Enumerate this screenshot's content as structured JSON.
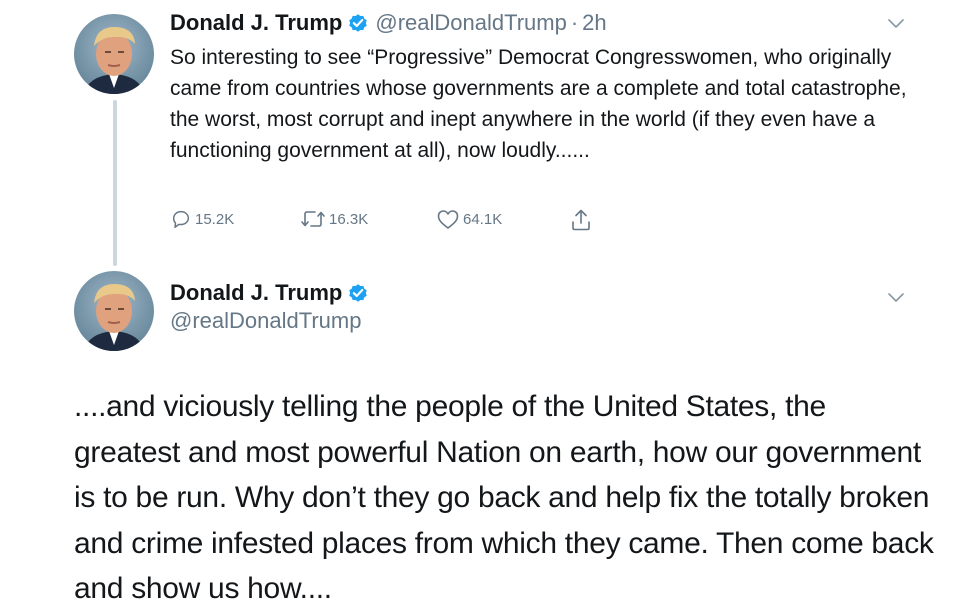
{
  "tweets": [
    {
      "author": {
        "name": "Donald J. Trump",
        "handle": "@realDonaldTrump",
        "verified": true,
        "avatar": "profile-photo"
      },
      "time": "2h",
      "separator": "·",
      "text": "So interesting to see “Progressive” Democrat Congresswomen, who originally came from countries whose governments are a complete and total catastrophe, the worst, most corrupt and inept anywhere in the world (if they even have a functioning government at all), now loudly......",
      "actions": {
        "reply": {
          "icon": "reply-icon",
          "count": "15.2K"
        },
        "retweet": {
          "icon": "retweet-icon",
          "count": "16.3K"
        },
        "like": {
          "icon": "heart-icon",
          "count": "64.1K"
        },
        "share": {
          "icon": "share-icon"
        }
      }
    },
    {
      "author": {
        "name": "Donald J. Trump",
        "handle": "@realDonaldTrump",
        "verified": true,
        "avatar": "profile-photo"
      },
      "text": "....and viciously telling the people of the United States, the greatest and most powerful Nation on earth, how our government is to be run. Why don’t they go back and help fix the totally broken and crime infested places from which they came. Then come back and show us how...."
    }
  ],
  "colors": {
    "verified_blue": "#1da1f2",
    "secondary_text": "#657786",
    "primary_text": "#14171a",
    "thread_line": "#ccd6dd"
  }
}
